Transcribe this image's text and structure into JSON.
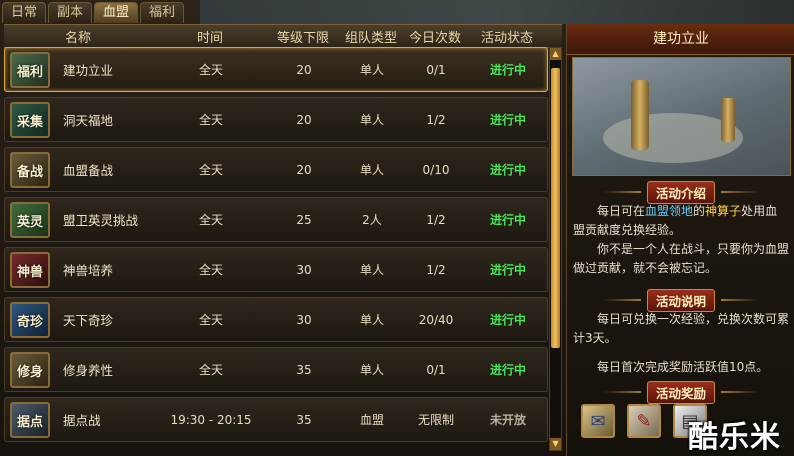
{
  "tabs": [
    "日常",
    "副本",
    "血盟",
    "福利"
  ],
  "active_tab": "血盟",
  "columns": [
    "名称",
    "时间",
    "等级下限",
    "组队类型",
    "今日次数",
    "活动状态"
  ],
  "rows": [
    {
      "badge": "福利",
      "name": "建功立业",
      "time": "全天",
      "level": "20",
      "team": "单人",
      "count": "0/1",
      "status": "进行中"
    },
    {
      "badge": "采集",
      "name": "洞天福地",
      "time": "全天",
      "level": "20",
      "team": "单人",
      "count": "1/2",
      "status": "进行中"
    },
    {
      "badge": "备战",
      "name": "血盟备战",
      "time": "全天",
      "level": "20",
      "team": "单人",
      "count": "0/10",
      "status": "进行中"
    },
    {
      "badge": "英灵",
      "name": "盟卫英灵挑战",
      "time": "全天",
      "level": "25",
      "team": "2人",
      "count": "1/2",
      "status": "进行中"
    },
    {
      "badge": "神兽",
      "name": "神兽培养",
      "time": "全天",
      "level": "30",
      "team": "单人",
      "count": "1/2",
      "status": "进行中"
    },
    {
      "badge": "奇珍",
      "name": "天下奇珍",
      "time": "全天",
      "level": "30",
      "team": "单人",
      "count": "20/40",
      "status": "进行中"
    },
    {
      "badge": "修身",
      "name": "修身养性",
      "time": "全天",
      "level": "35",
      "team": "单人",
      "count": "0/1",
      "status": "进行中"
    },
    {
      "badge": "据点",
      "name": "据点战",
      "time": "19:30 - 20:15",
      "level": "35",
      "team": "血盟",
      "count": "无限制",
      "status": "未开放"
    }
  ],
  "detail": {
    "title": "建功立业",
    "intro_label": "活动介绍",
    "intro_p1_a": "每日可在",
    "intro_p1_b": "血盟领地",
    "intro_p1_c": "的",
    "intro_p1_d": "神算子",
    "intro_p1_e": "处用血盟贡献度兑换经验。",
    "intro_p2": "你不是一个人在战斗，只要你为血盟做过贡献，就不会被忘记。",
    "desc_label": "活动说明",
    "desc_p1": "每日可兑换一次经验，兑换次数可累计3天。",
    "desc_p2": "每日首次完成奖励活跃值10点。",
    "reward_label": "活动奖励",
    "rewards": [
      "scroll-icon",
      "letter-icon",
      "card-icon"
    ]
  },
  "watermark": "酷乐米",
  "colors": {
    "active_status": "#49e35b",
    "inactive_status": "#b7b0a0",
    "selected_border": "#d8a848"
  }
}
